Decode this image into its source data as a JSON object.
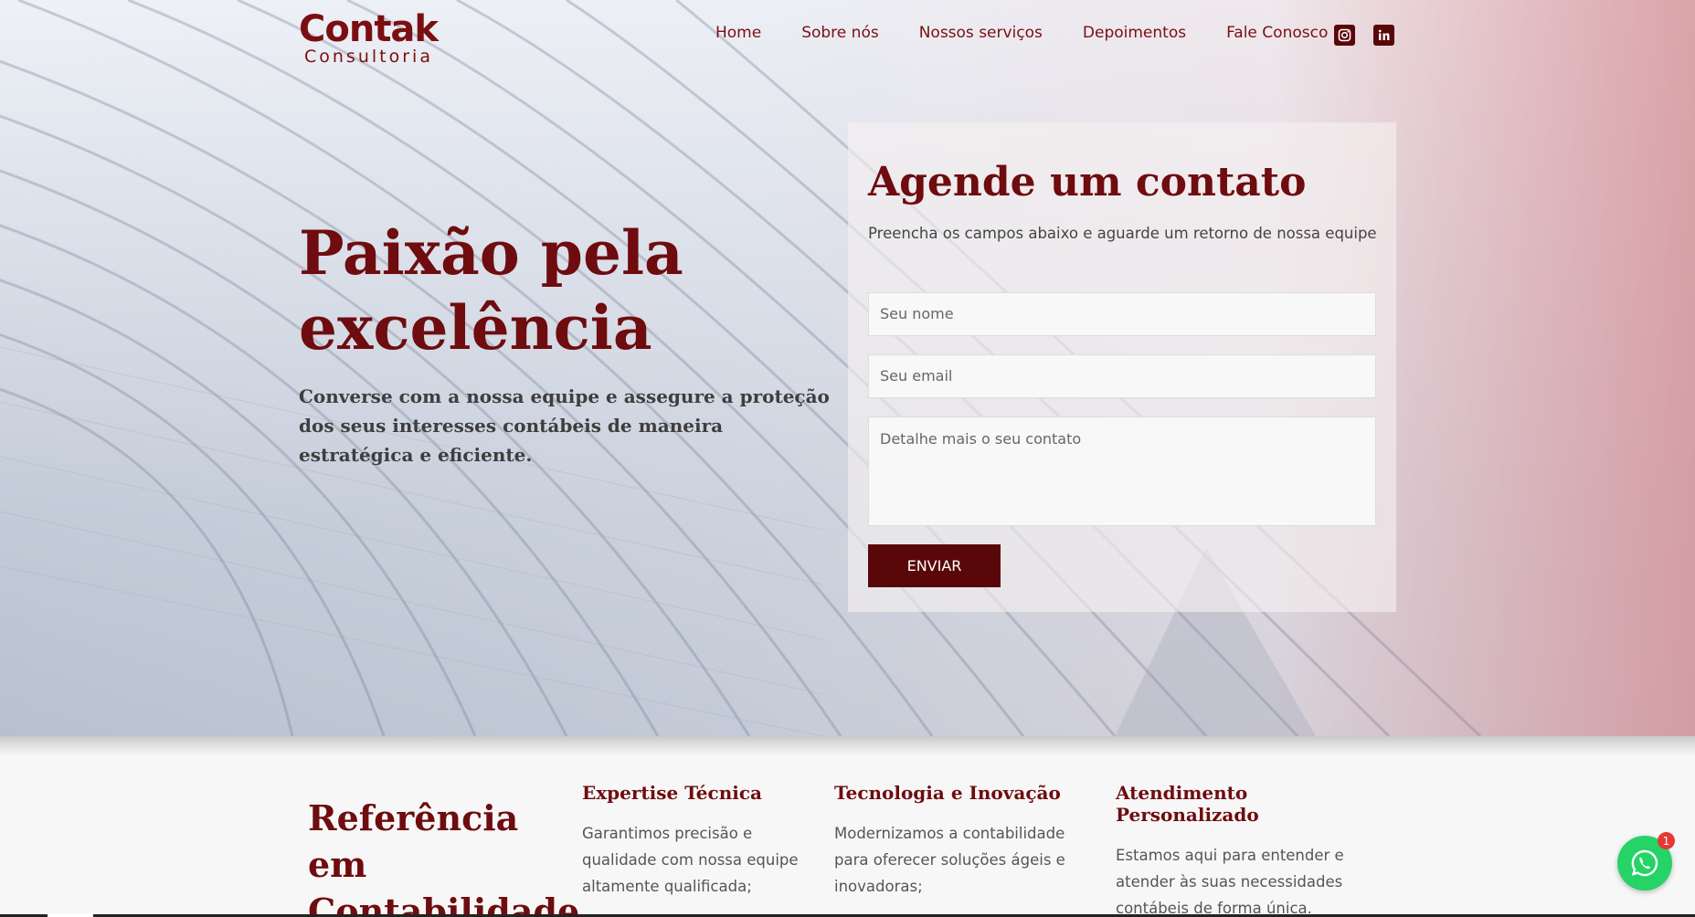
{
  "logo": {
    "brand": "Contak",
    "sub": "Consultoria"
  },
  "nav": [
    "Home",
    "Sobre nós",
    "Nossos serviços",
    "Depoimentos",
    "Fale Conosco"
  ],
  "social": {
    "icons": [
      "instagram-icon",
      "linkedin-icon"
    ]
  },
  "hero": {
    "title": "Paixão pela excelência",
    "lead": "Converse com a nossa equipe e assegure a proteção dos seus interesses contábeis de maneira estratégica e eficiente."
  },
  "form": {
    "title": "Agende um contato",
    "subtitle": "Preencha os campos abaixo e aguarde um retorno de nossa equipe",
    "name_placeholder": "Seu nome",
    "email_placeholder": "Seu email",
    "message_placeholder": "Detalhe mais o seu contato",
    "submit_label": "ENVIAR"
  },
  "reference": {
    "title": "Referência em Contabilidade"
  },
  "features": [
    {
      "title": "Expertise Técnica",
      "text": "Garantimos precisão e qualidade com nossa equipe altamente qualificada;"
    },
    {
      "title": "Tecnologia e Inovação",
      "text": "Modernizamos a contabilidade para oferecer soluções ágeis e inovadoras;"
    },
    {
      "title": "Atendimento Personalizado",
      "text": "Estamos aqui para entender e atender às suas necessidades contábeis de forma única."
    }
  ],
  "whatsapp": {
    "badge": "1"
  },
  "colors": {
    "brand": "#6e0c0f",
    "button": "#5a0709",
    "whatsapp": "#25d366"
  }
}
